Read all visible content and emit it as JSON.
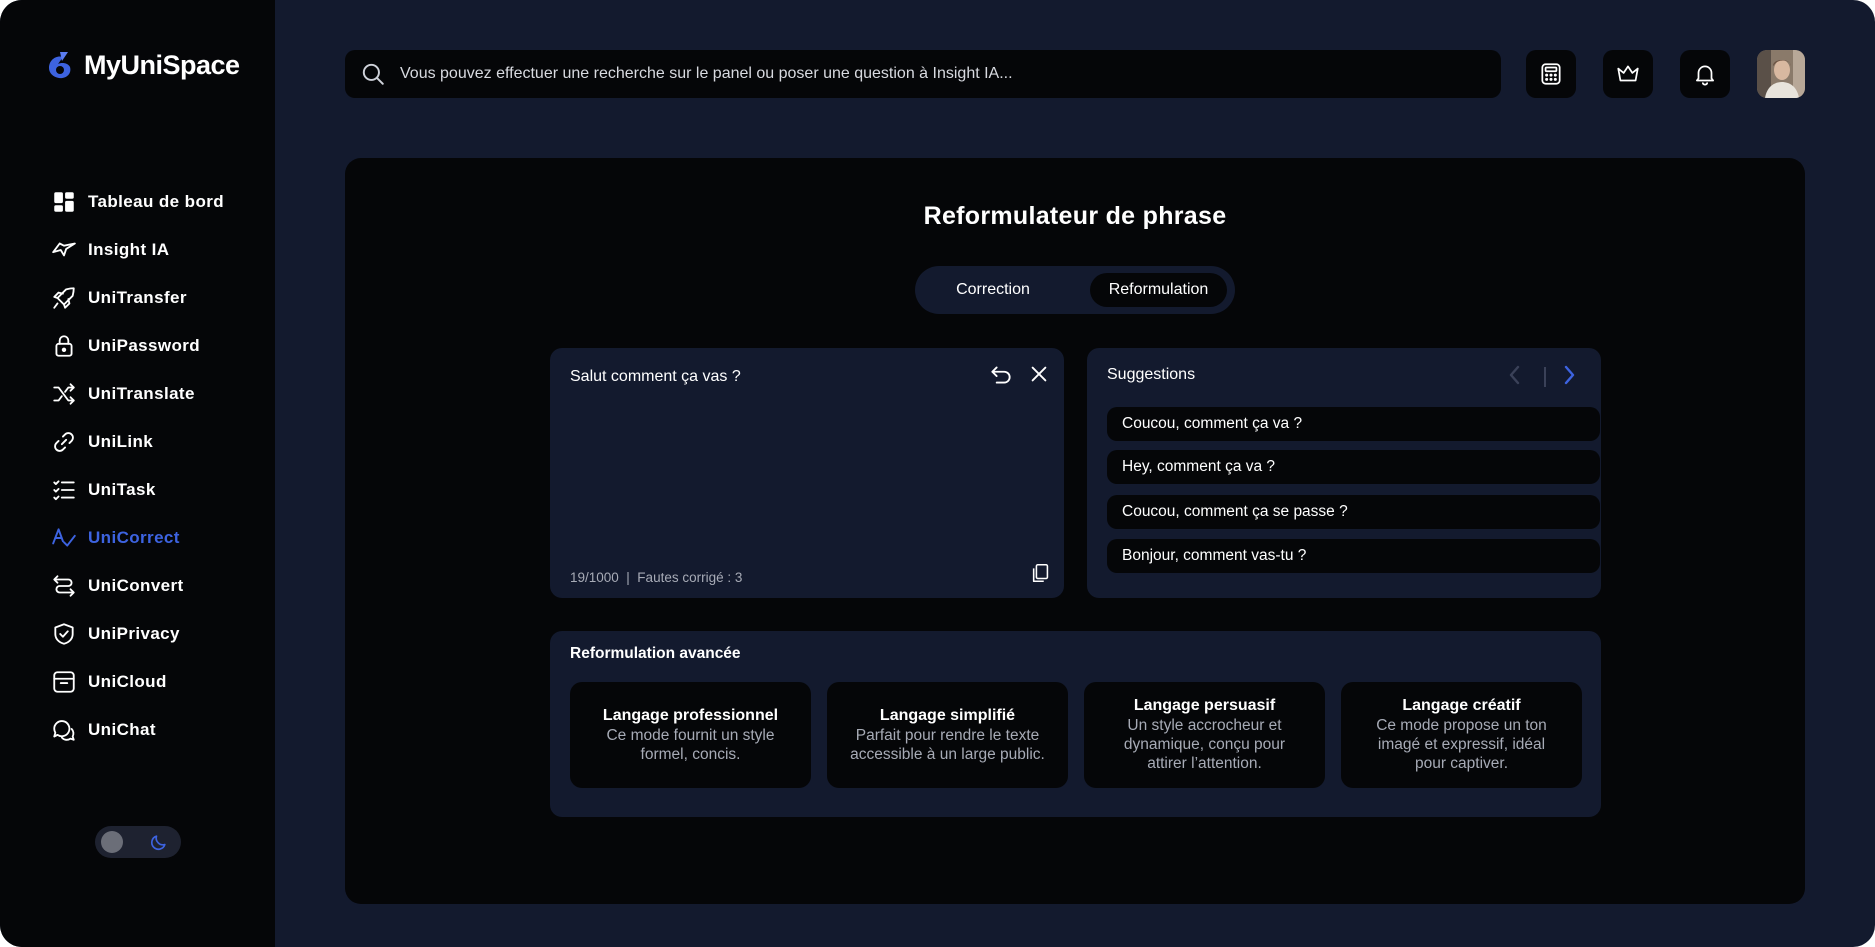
{
  "app": {
    "name": "MyUniSpace"
  },
  "colors": {
    "accent": "#3d63e0",
    "background": "#131a2e",
    "panel": "#050608"
  },
  "sidebar": {
    "items": [
      {
        "label": "Tableau de bord",
        "icon": "dashboard-icon",
        "active": false
      },
      {
        "label": "Insight IA",
        "icon": "plane-icon",
        "active": false
      },
      {
        "label": "UniTransfer",
        "icon": "rocket-icon",
        "active": false
      },
      {
        "label": "UniPassword",
        "icon": "lock-icon",
        "active": false
      },
      {
        "label": "UniTranslate",
        "icon": "shuffle-icon",
        "active": false
      },
      {
        "label": "UniLink",
        "icon": "link-icon",
        "active": false
      },
      {
        "label": "UniTask",
        "icon": "task-list-icon",
        "active": false
      },
      {
        "label": "UniCorrect",
        "icon": "correct-icon",
        "active": true
      },
      {
        "label": "UniConvert",
        "icon": "convert-icon",
        "active": false
      },
      {
        "label": "UniPrivacy",
        "icon": "shield-icon",
        "active": false
      },
      {
        "label": "UniCloud",
        "icon": "archive-icon",
        "active": false
      },
      {
        "label": "UniChat",
        "icon": "chat-icon",
        "active": false
      }
    ],
    "theme_toggle": {
      "icon": "moon-icon",
      "mode": "dark"
    }
  },
  "search": {
    "placeholder": "Vous pouvez effectuer une recherche sur le panel ou poser une question à Insight IA..."
  },
  "topbar": {
    "icons": [
      "calculator-icon",
      "crown-icon",
      "bell-icon"
    ],
    "avatar": "user-avatar"
  },
  "main": {
    "title": "Reformulateur de phrase",
    "tabs": [
      {
        "label": "Correction",
        "selected": false
      },
      {
        "label": "Reformulation",
        "selected": true
      }
    ],
    "editor": {
      "text": "Salut comment ça vas ?",
      "footer": "19/1000  |  Fautes corrigé : 3"
    },
    "suggestions": {
      "heading": "Suggestions",
      "items": [
        "Coucou, comment ça va ?",
        "Hey, comment ça va ?",
        "Coucou, comment ça se passe ?",
        "Bonjour, comment vas-tu ?"
      ]
    },
    "advanced": {
      "heading": "Reformulation avancée",
      "modes": [
        {
          "title": "Langage professionnel",
          "desc": "Ce mode fournit un style formel, concis."
        },
        {
          "title": "Langage simplifié",
          "desc": "Parfait pour rendre le texte accessible à un large public."
        },
        {
          "title": "Langage persuasif",
          "desc": "Un style accrocheur et dynamique, conçu pour attirer l’attention."
        },
        {
          "title": "Langage créatif",
          "desc": "Ce mode propose un ton imagé et expressif, idéal pour captiver."
        }
      ]
    }
  }
}
